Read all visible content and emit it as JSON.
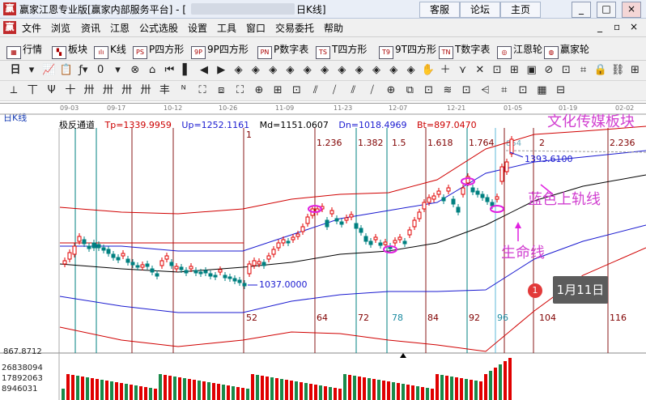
{
  "window": {
    "app_icon": "赢",
    "title": "赢家江恩专业版[赢家内部服务平台] - [",
    "title_tail": "日K线]",
    "buttons": [
      "客服",
      "论坛",
      "主页"
    ],
    "controls": [
      "_",
      "□",
      "×"
    ]
  },
  "menu": {
    "logo": "赢",
    "items": [
      "文件",
      "浏览",
      "资讯",
      "江恩",
      "公式选股",
      "设置",
      "工具",
      "窗口",
      "交易委托",
      "帮助"
    ],
    "mdi_controls": [
      "_",
      "▫",
      "×"
    ]
  },
  "toolbar1": {
    "items": [
      {
        "label": "行情",
        "icon": "grid-icon",
        "glyph": "▦"
      },
      {
        "label": "板块",
        "icon": "blocks-icon",
        "glyph": "▚"
      },
      {
        "label": "K线",
        "icon": "kline-icon",
        "glyph": "ılı"
      },
      {
        "label": "P四方形",
        "icon": "ps-icon",
        "glyph": "PS"
      },
      {
        "label": "9P四方形",
        "icon": "9p-icon",
        "glyph": "9P"
      },
      {
        "label": "P数字表",
        "icon": "pn-icon",
        "glyph": "PN"
      },
      {
        "label": "T四方形",
        "icon": "ts-icon",
        "glyph": "TS"
      },
      {
        "label": "9T四方形",
        "icon": "t9-icon",
        "glyph": "T9"
      },
      {
        "label": "T数字表",
        "icon": "tn-icon",
        "glyph": "TN"
      },
      {
        "label": "江恩轮",
        "icon": "gann-wheel-icon",
        "glyph": "◎"
      },
      {
        "label": "赢家轮",
        "icon": "winner-wheel-icon",
        "glyph": "◍"
      }
    ]
  },
  "toolbar2": {
    "period": "日",
    "glyphs": [
      "▾",
      "📈",
      "📋",
      "ƒ▾",
      "0",
      "▾",
      "⊗",
      "⌂",
      "⏮",
      "▌",
      "◀",
      "▶",
      "◈",
      "◈",
      "◈",
      "◈",
      "◈",
      "◈",
      "◈",
      "◈",
      "◈",
      "◈",
      "◈",
      "✋",
      "＋",
      "⋎",
      "✕",
      "⊡",
      "⊞",
      "▣",
      "⊘",
      "⊡",
      "⌗",
      "🔒",
      "⛓",
      "⊞"
    ]
  },
  "toolbar3": {
    "glyphs": [
      "⟂",
      "丅",
      "Ψ",
      "十",
      "卅",
      "卅",
      "卅",
      "卅",
      "丰",
      "ᴺ",
      "⛶",
      "⧈",
      "⛶",
      "⊕",
      "⊞",
      "⊡",
      "⫽",
      "⧸",
      "⫽",
      "⧸",
      "⊕",
      "⧉",
      "⊡",
      "≋",
      "⊡",
      "⩤",
      "⌗",
      "⊡",
      "▦",
      "⊟"
    ]
  },
  "chart": {
    "period_label": "日K线",
    "indicator": {
      "name": "极反通道",
      "tp": "Tp=1339.9959",
      "up": "Up=1252.1161",
      "md": "Md=1151.0607",
      "dn": "Dn=1018.4969",
      "bt": "Bt=897.0470"
    },
    "dates": [
      "09-03",
      "09-17",
      "10-12",
      "10-26",
      "11-09",
      "11-23",
      "12-07",
      "12-21",
      "01-05",
      "01-19",
      "02-02"
    ],
    "fib_labels": [
      "1",
      "1.236",
      "1.382",
      "1.5",
      "1.618",
      "1.764",
      "2",
      "2.236"
    ],
    "fib_overflow_label": "854",
    "day_counts": [
      "52",
      "64",
      "72",
      "78",
      "84",
      "92",
      "96",
      "104",
      "116"
    ],
    "price_low_label": "1037.0000",
    "price_high_label": "1393.6100",
    "price_axis_label": "867.8712",
    "volume_labels": [
      "26838094",
      "17892063",
      "8946031"
    ],
    "annotations": {
      "sector": "文化传媒板块",
      "upper_band": "蓝色上轨线",
      "life_line": "生命线"
    },
    "tooltip": {
      "num": "1",
      "text": "1月11日"
    },
    "colors": {
      "up": "#e00000",
      "down": "#008080",
      "upper_band": "#1a1ad0",
      "mid_band": "#000000",
      "outer_band": "#d00000",
      "highlight": "#e020e0"
    }
  }
}
